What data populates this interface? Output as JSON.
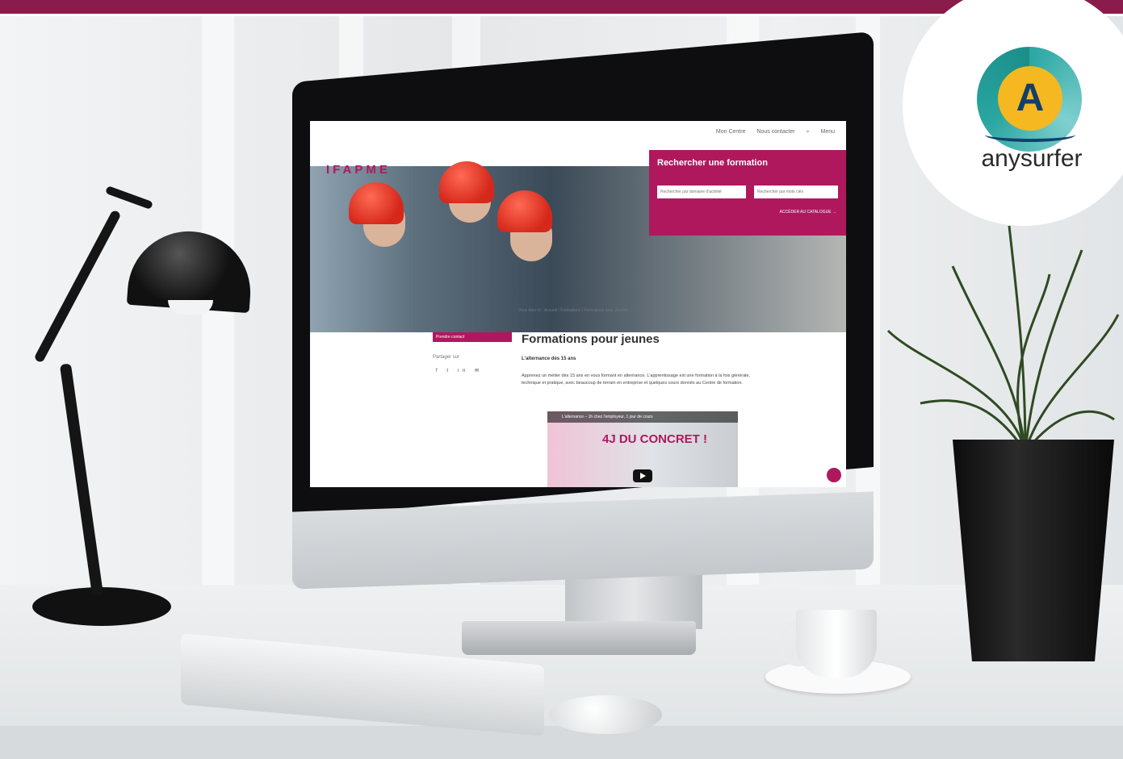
{
  "badge": {
    "brand": "anysurfer",
    "letter": "A"
  },
  "site": {
    "logo": "IFAPME",
    "nav": [
      "Mon Centre",
      "Nous contacter",
      "Menu"
    ],
    "search_title": "Rechercher une formation",
    "search_domain_placeholder": "Rechercher par domaine d'activité",
    "search_keyword_placeholder": "Rechercher par mots clés",
    "search_link": "ACCÉDER AU CATALOGUE →",
    "breadcrumb": "Vous êtes ici : Accueil / Formations / Formations pour Jeunes",
    "sidebar_button": "Prendre contact",
    "share_label": "Partager sur",
    "social": "f t in ✉",
    "page_title": "Formations pour jeunes",
    "subtitle": "L'alternance dès 15 ans",
    "body": "Apprenez un métier dès 15 ans en vous formant en alternance. L'apprentissage est une formation à la fois générale, technique et pratique, avec beaucoup de terrain en entreprise et quelques cours donnés au Centre de formation.",
    "video_title": "L'alternance – 1h chez l'employeur, 1 jour de cours",
    "video_banner": "4J DU CONCRET !"
  },
  "colors": {
    "brand": "#b0185e",
    "top_bar": "#8a1c4c",
    "badge_teal": "#2aa6a1",
    "badge_gold": "#f5b820"
  }
}
